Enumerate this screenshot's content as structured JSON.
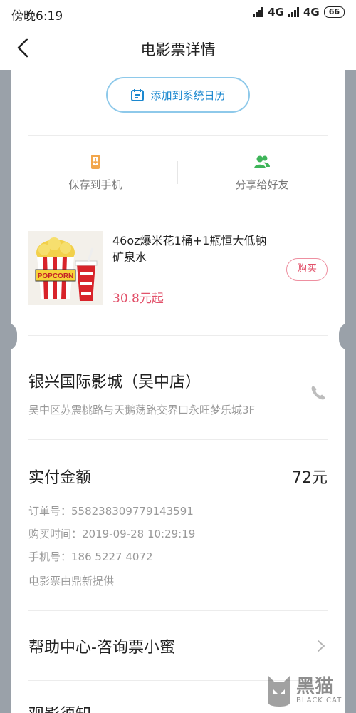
{
  "status_bar": {
    "time": "傍晚6:19",
    "network_1": "4G",
    "network_2": "4G",
    "battery": "66"
  },
  "nav": {
    "title": "电影票详情",
    "back_icon": "chevron-left-icon"
  },
  "calendar_button": {
    "label": "添加到系统日历",
    "icon": "calendar-icon"
  },
  "actions": [
    {
      "label": "保存到手机",
      "icon": "phone-download-icon",
      "color": "#f2a64b"
    },
    {
      "label": "分享给好友",
      "icon": "users-icon",
      "color": "#3fb55a"
    }
  ],
  "product": {
    "title": "46oz爆米花1桶+1瓶恒大低钠矿泉水",
    "price": "30.8元起",
    "buy_label": "购买",
    "image_text": "POPCORN"
  },
  "cinema": {
    "name": "银兴国际影城（吴中店）",
    "address": "吴中区苏震桃路与天鹅荡路交界口永旺梦乐城3F",
    "phone_icon": "phone-icon"
  },
  "payment": {
    "label": "实付金额",
    "amount": "72元",
    "order_no": "订单号：558238309779143591",
    "purchase_time": "购买时间：2019-09-28 10:29:19",
    "phone": "手机号：186 5227 4072",
    "provider": "电影票由鼎新提供"
  },
  "help": {
    "label": "帮助中心-咨询票小蜜"
  },
  "notice": {
    "label": "观影须知"
  },
  "watermark": {
    "cn": "黑猫",
    "en": "BLACK CAT"
  },
  "colors": {
    "accent_blue": "#1c88cf",
    "price_red": "#e2516a",
    "background_gray": "#9aa1a9"
  }
}
